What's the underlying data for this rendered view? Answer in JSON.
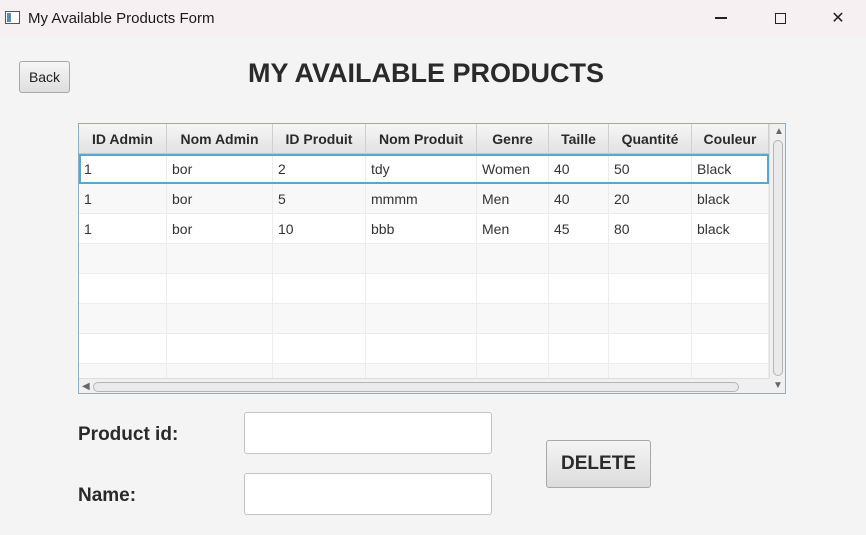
{
  "window": {
    "title": "My Available Products Form",
    "controls": {
      "minimize": "",
      "maximize": "",
      "close": "✕"
    }
  },
  "header": {
    "back_label": "Back",
    "title": "MY AVAILABLE PRODUCTS"
  },
  "table": {
    "columns": [
      "ID Admin",
      "Nom Admin",
      "ID Produit",
      "Nom Produit",
      "Genre",
      "Taille",
      "Quantité",
      "Couleur"
    ],
    "rows": [
      [
        "1",
        "bor",
        "2",
        "tdy",
        "Women",
        "40",
        "50",
        "Black"
      ],
      [
        "1",
        "bor",
        "5",
        "mmmm",
        "Men",
        "40",
        "20",
        "black"
      ],
      [
        "1",
        "bor",
        "10",
        "bbb",
        "Men",
        "45",
        "80",
        "black"
      ]
    ],
    "selected_row": 0,
    "scroll": {
      "up_arrow": "▲",
      "down_arrow": "▼",
      "left_arrow": "◀"
    }
  },
  "form": {
    "product_id_label": "Product id:",
    "product_id_value": "",
    "name_label": "Name:",
    "name_value": "",
    "delete_label": "DELETE"
  }
}
